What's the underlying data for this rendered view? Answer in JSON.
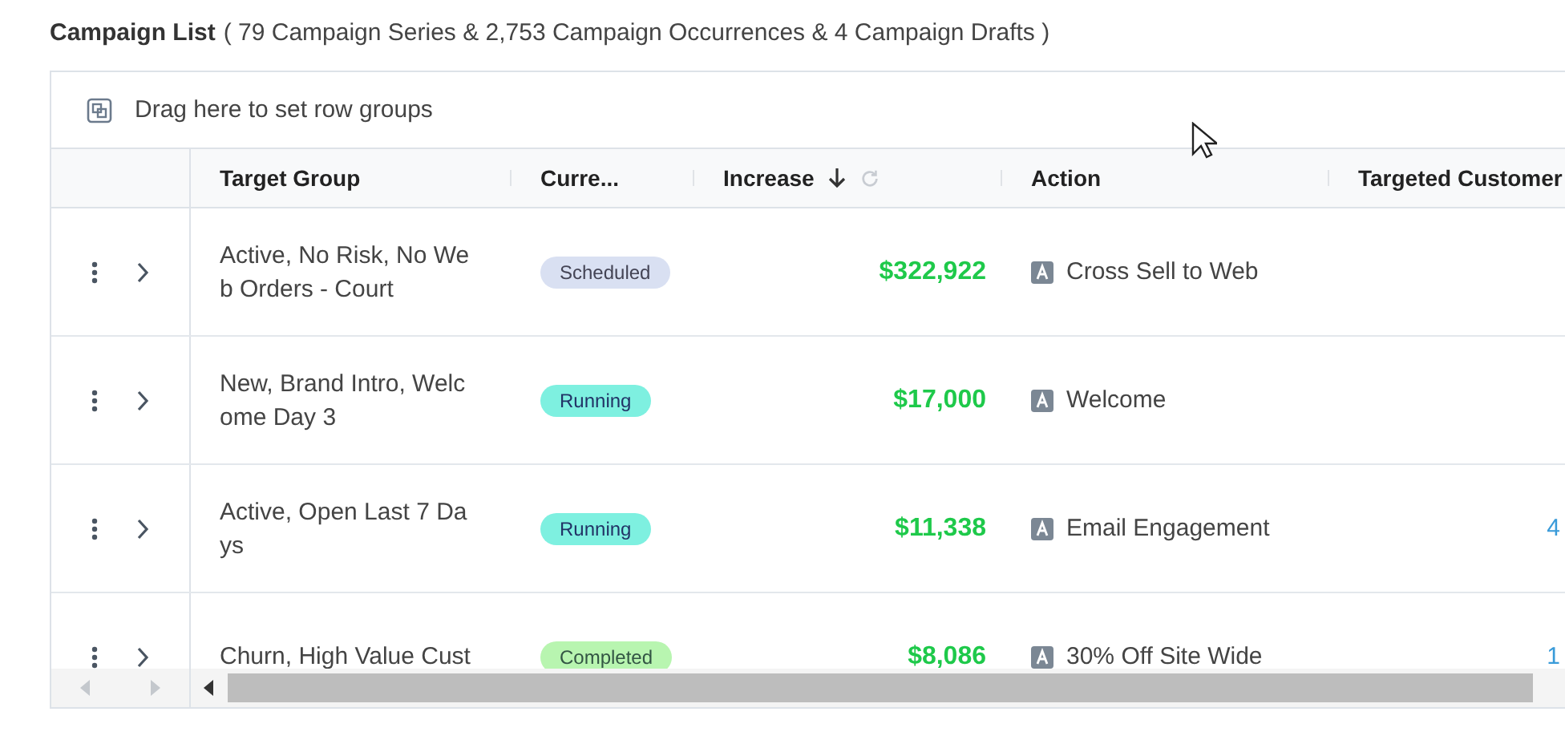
{
  "header": {
    "title": "Campaign List",
    "summary": "( 79 Campaign Series & 2,753 Campaign Occurrences & 4 Campaign Drafts )"
  },
  "group_bar": {
    "placeholder": "Drag here to set row groups"
  },
  "table": {
    "columns": [
      {
        "label": "Target Group",
        "sorted": false
      },
      {
        "label": "Curre...",
        "sorted": false
      },
      {
        "label": "Increase",
        "sorted": true
      },
      {
        "label": "Action",
        "sorted": false
      },
      {
        "label": "Targeted Customer"
      }
    ],
    "rows": [
      {
        "target_group": "Active, No Risk, No Web Orders - Court",
        "status": {
          "label": "Scheduled",
          "kind": "scheduled"
        },
        "increase": "$322,922",
        "action": "Cross Sell to Web"
      },
      {
        "target_group": "New, Brand Intro, Welcome Day 3",
        "status": {
          "label": "Running",
          "kind": "running"
        },
        "increase": "$17,000",
        "action": "Welcome"
      },
      {
        "target_group": "Active, Open Last 7 Days",
        "status": {
          "label": "Running",
          "kind": "running"
        },
        "increase": "$11,338",
        "action": "Email Engagement",
        "targeted": "4"
      },
      {
        "target_group": "Churn, High Value Cust",
        "status": {
          "label": "Completed",
          "kind": "completed"
        },
        "increase": "$8,086",
        "action": "30% Off Site Wide",
        "targeted": "1"
      }
    ]
  }
}
